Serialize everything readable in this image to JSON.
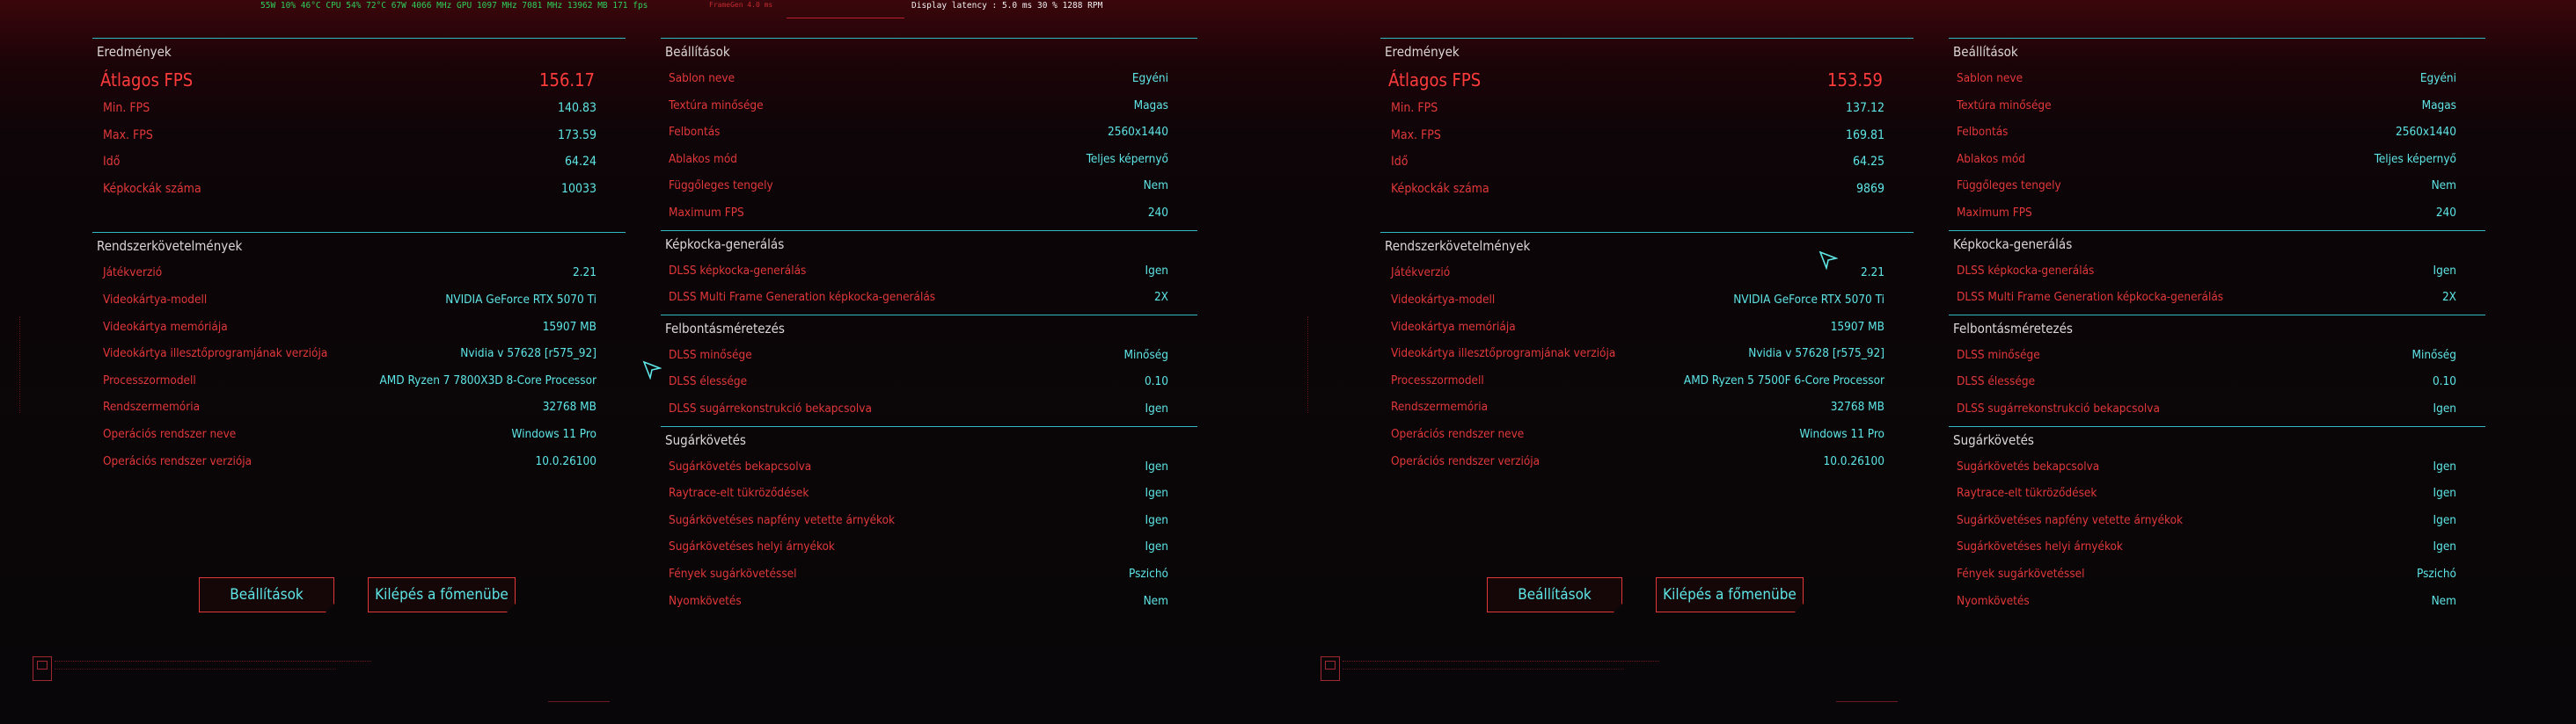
{
  "overlay": {
    "perf": "55W  10%  46°C CPU 54%  72°C 67W 4066 MHz GPU 1097 MHz 7081 MHz  13962 MB 171 fps",
    "frame_gen": "FrameGen 4.0 ms",
    "latency": "Display latency : 5.0 ms   30 %  1288 RPM"
  },
  "runs": [
    {
      "results": {
        "title": "Eredmények",
        "avg_label": "Átlagos FPS",
        "avg_value": "156.17",
        "min_label": "Min. FPS",
        "min_value": "140.83",
        "max_label": "Max. FPS",
        "max_value": "173.59",
        "time_label": "Idő",
        "time_value": "64.24",
        "frames_label": "Képkockák száma",
        "frames_value": "10033"
      },
      "system": {
        "title": "Rendszerkövetelmények",
        "rows": [
          {
            "k": "Játékverzió",
            "v": "2.21"
          },
          {
            "k": "Videokártya-modell",
            "v": "NVIDIA GeForce RTX 5070 Ti"
          },
          {
            "k": "Videokártya memóriája",
            "v": "15907 MB"
          },
          {
            "k": "Videokártya illesztőprogramjának verziója",
            "v": "Nvidia v 57628 [r575_92]"
          },
          {
            "k": "Processzormodell",
            "v": "AMD Ryzen 7 7800X3D 8-Core Processor"
          },
          {
            "k": "Rendszermemória",
            "v": "32768 MB"
          },
          {
            "k": "Operációs rendszer neve",
            "v": "Windows 11 Pro"
          },
          {
            "k": "Operációs rendszer verziója",
            "v": "10.0.26100"
          }
        ]
      }
    },
    {
      "results": {
        "title": "Eredmények",
        "avg_label": "Átlagos FPS",
        "avg_value": "153.59",
        "min_label": "Min. FPS",
        "min_value": "137.12",
        "max_label": "Max. FPS",
        "max_value": "169.81",
        "time_label": "Idő",
        "time_value": "64.25",
        "frames_label": "Képkockák száma",
        "frames_value": "9869"
      },
      "system": {
        "title": "Rendszerkövetelmények",
        "rows": [
          {
            "k": "Játékverzió",
            "v": "2.21"
          },
          {
            "k": "Videokártya-modell",
            "v": "NVIDIA GeForce RTX 5070 Ti"
          },
          {
            "k": "Videokártya memóriája",
            "v": "15907 MB"
          },
          {
            "k": "Videokártya illesztőprogramjának verziója",
            "v": "Nvidia v 57628 [r575_92]"
          },
          {
            "k": "Processzormodell",
            "v": "AMD Ryzen 5 7500F 6-Core Processor"
          },
          {
            "k": "Rendszermemória",
            "v": "32768 MB"
          },
          {
            "k": "Operációs rendszer neve",
            "v": "Windows 11 Pro"
          },
          {
            "k": "Operációs rendszer verziója",
            "v": "10.0.26100"
          }
        ]
      }
    }
  ],
  "settings": {
    "title": "Beállítások",
    "rows": [
      {
        "k": "Sablon neve",
        "v": "Egyéni"
      },
      {
        "k": "Textúra minősége",
        "v": "Magas"
      },
      {
        "k": "Felbontás",
        "v": "2560x1440"
      },
      {
        "k": "Ablakos mód",
        "v": "Teljes képernyő"
      },
      {
        "k": "Függőleges tengely",
        "v": "Nem"
      },
      {
        "k": "Maximum FPS",
        "v": "240"
      }
    ]
  },
  "framegen": {
    "title": "Képkocka-generálás",
    "rows": [
      {
        "k": "DLSS képkocka-generálás",
        "v": "Igen"
      },
      {
        "k": "DLSS Multi Frame Generation képkocka-generálás",
        "v": "2X"
      }
    ]
  },
  "scaling": {
    "title": "Felbontásméretezés",
    "rows": [
      {
        "k": "DLSS minősége",
        "v": "Minőség"
      },
      {
        "k": "DLSS élessége",
        "v": "0.10"
      },
      {
        "k": "DLSS sugárrekonstrukció bekapcsolva",
        "v": "Igen"
      }
    ]
  },
  "raytracing": {
    "title": "Sugárkövetés",
    "rows": [
      {
        "k": "Sugárkövetés bekapcsolva",
        "v": "Igen"
      },
      {
        "k": "Raytrace-elt tükröződések",
        "v": "Igen"
      },
      {
        "k": "Sugárkövetéses napfény vetette árnyékok",
        "v": "Igen"
      },
      {
        "k": "Sugárkövetéses helyi árnyékok",
        "v": "Igen"
      },
      {
        "k": "Fények sugárkövetéssel",
        "v": "Pszichó"
      },
      {
        "k": "Nyomkövetés",
        "v": "Nem"
      }
    ]
  },
  "buttons": {
    "settings": "Beállítások",
    "exit": "Kilépés a főmenübe"
  },
  "icons": {
    "cursor": "cursor-arrow-icon",
    "footer": "logo-icon"
  }
}
